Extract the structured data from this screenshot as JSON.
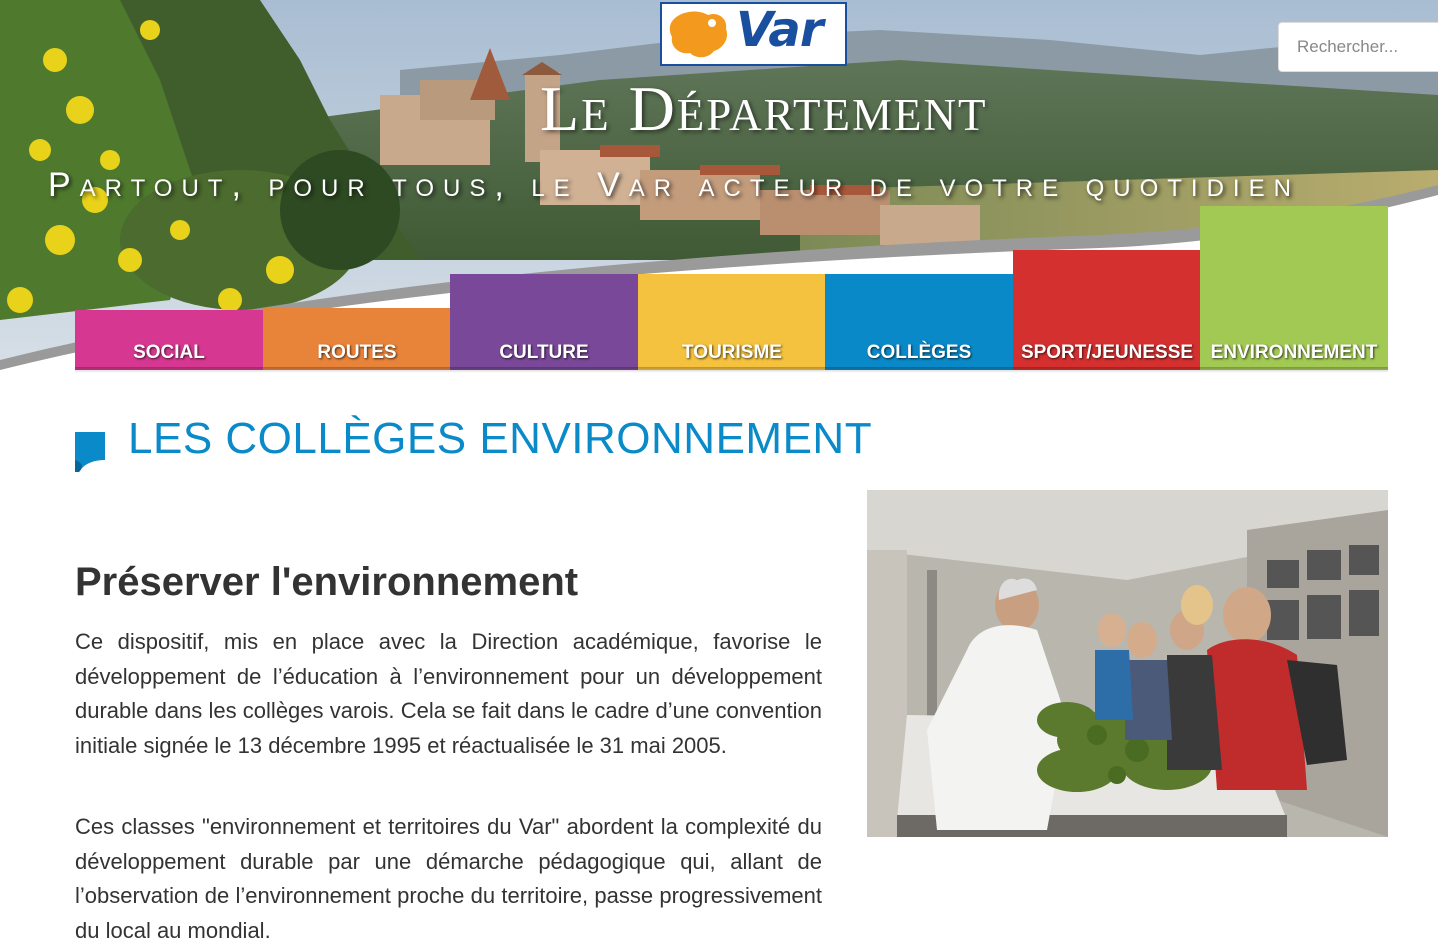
{
  "header": {
    "logo_text": "Var",
    "department_title": "Le Département",
    "tagline": "Partout, pour tous, le Var acteur de votre quotidien",
    "search_placeholder": "Rechercher..."
  },
  "nav": {
    "items": [
      {
        "label": "SOCIAL",
        "color": "#d63790"
      },
      {
        "label": "ROUTES",
        "color": "#e8833a"
      },
      {
        "label": "CULTURE",
        "color": "#7a4899"
      },
      {
        "label": "TOURISME",
        "color": "#f4c23f"
      },
      {
        "label": "COLLÈGES",
        "color": "#0a89c9"
      },
      {
        "label": "SPORT/JEUNESSE",
        "color": "#d3302f"
      },
      {
        "label": "ENVIRONNEMENT",
        "color": "#a3c955"
      }
    ]
  },
  "main": {
    "page_title": "LES COLLÈGES ENVIRONNEMENT",
    "section_heading": "Préserver l'environnement",
    "paragraph_1": "Ce dispositif, mis en place avec la Direction académique, favorise le développement de l’éducation à l’environnement pour un développement durable dans les collèges varois. Cela se fait dans le cadre d’une convention initiale signée le 13 décembre 1995 et réactualisée le 31 mai 2005.",
    "paragraph_2": "Ces classes \"environnement et territoires du Var\" abordent la complexité du développement durable par une démarche pédagogique qui, allant de l’observation de l’environnement proche du territoire, passe progressivement du local au mondial."
  },
  "colors": {
    "title_blue": "#0a8ac9",
    "logo_blue": "#1a4fa0",
    "logo_orange": "#f39a1e"
  }
}
